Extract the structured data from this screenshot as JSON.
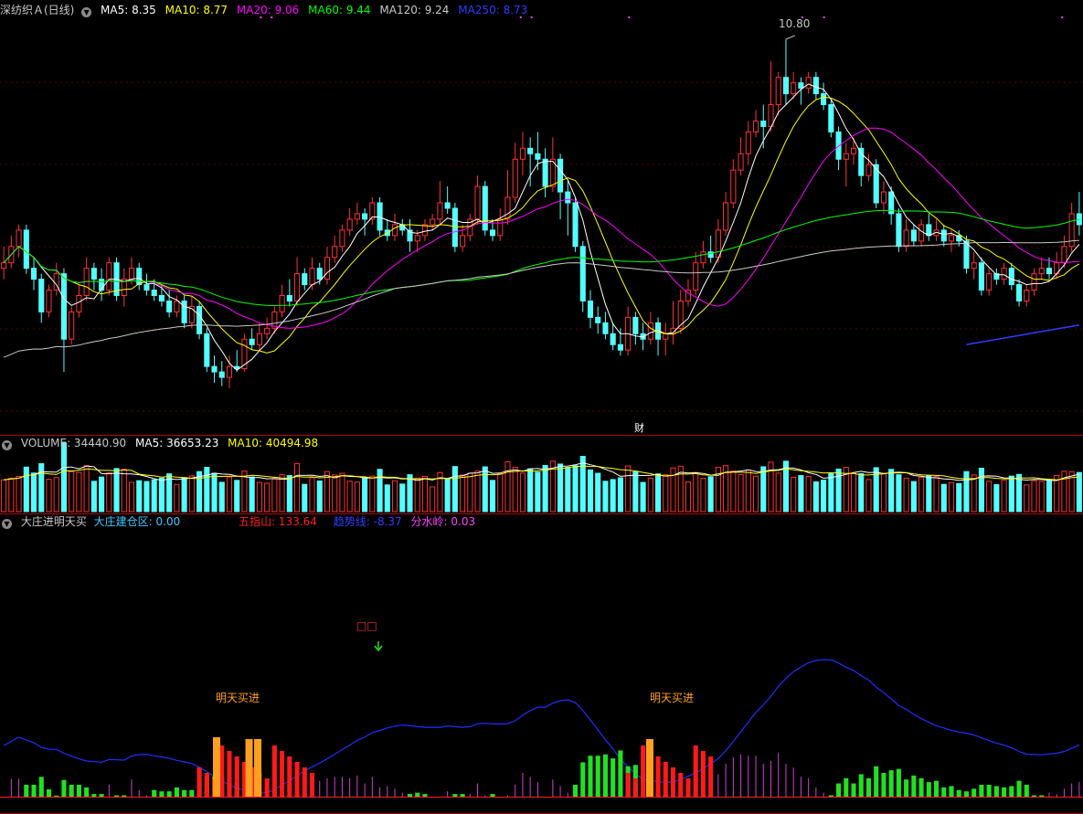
{
  "header_main": {
    "title": "深纺织Ａ(日线)",
    "ma5": "MA5: 8.35",
    "ma10": "MA10: 8.77",
    "ma20": "MA20: 9.06",
    "ma60": "MA60: 9.44",
    "ma120": "MA120: 9.24",
    "ma250": "MA250: 8.73",
    "colors": {
      "ma5": "#ffffff",
      "ma10": "#ffff00",
      "ma20": "#ff00ff",
      "ma60": "#00ff00",
      "ma120": "#c8c8c8",
      "ma250": "#2f3cff"
    }
  },
  "header_volume": {
    "volume": "VOLUME: 34440.90",
    "ma5": "MA5: 36653.23",
    "ma10": "MA10: 40494.98"
  },
  "header_indicator": {
    "name": "大庄进明天买",
    "build": "大庄建仓区: 0.00",
    "five": "五指山: 133.64",
    "trend": "趋势线: -8.37",
    "divide": "分水岭: 0.03"
  },
  "annotations": {
    "high_price": "10.80",
    "finance_marker": "财",
    "buy_signal_1": "明天买进",
    "buy_signal_2": "明天买进",
    "boxed_marker": "□□"
  },
  "chart_data": {
    "type": "candlestick",
    "price_range": [
      7.6,
      10.95
    ],
    "candles": [
      [
        8.7,
        8.75,
        8.9,
        8.6
      ],
      [
        8.75,
        8.9,
        9.0,
        8.7
      ],
      [
        8.9,
        9.05,
        9.1,
        8.8
      ],
      [
        9.05,
        8.7,
        9.1,
        8.65
      ],
      [
        8.7,
        8.6,
        8.8,
        8.5
      ],
      [
        8.6,
        8.3,
        8.65,
        8.2
      ],
      [
        8.3,
        8.5,
        8.55,
        8.25
      ],
      [
        8.5,
        8.65,
        8.75,
        8.45
      ],
      [
        8.65,
        8.05,
        8.7,
        7.75
      ],
      [
        8.05,
        8.3,
        8.35,
        8.0
      ],
      [
        8.3,
        8.45,
        8.55,
        8.25
      ],
      [
        8.45,
        8.7,
        8.8,
        8.4
      ],
      [
        8.7,
        8.6,
        8.75,
        8.5
      ],
      [
        8.6,
        8.5,
        8.7,
        8.4
      ],
      [
        8.5,
        8.75,
        8.8,
        8.45
      ],
      [
        8.75,
        8.45,
        8.8,
        8.4
      ],
      [
        8.45,
        8.6,
        8.7,
        8.35
      ],
      [
        8.6,
        8.7,
        8.8,
        8.55
      ],
      [
        8.7,
        8.55,
        8.75,
        8.5
      ],
      [
        8.55,
        8.5,
        8.65,
        8.45
      ],
      [
        8.5,
        8.45,
        8.6,
        8.4
      ],
      [
        8.45,
        8.4,
        8.55,
        8.35
      ],
      [
        8.4,
        8.3,
        8.5,
        8.25
      ],
      [
        8.3,
        8.4,
        8.45,
        8.25
      ],
      [
        8.4,
        8.2,
        8.45,
        8.15
      ],
      [
        8.2,
        8.35,
        8.45,
        8.15
      ],
      [
        8.35,
        8.1,
        8.4,
        8.05
      ],
      [
        8.1,
        7.8,
        8.15,
        7.75
      ],
      [
        7.8,
        7.75,
        7.9,
        7.65
      ],
      [
        7.75,
        7.7,
        7.85,
        7.62
      ],
      [
        7.7,
        7.8,
        7.9,
        7.6
      ],
      [
        7.8,
        7.78,
        7.95,
        7.75
      ],
      [
        7.78,
        8.05,
        8.1,
        7.75
      ],
      [
        8.05,
        8.0,
        8.15,
        7.95
      ],
      [
        8.0,
        8.1,
        8.2,
        7.95
      ],
      [
        8.1,
        8.15,
        8.25,
        8.05
      ],
      [
        8.15,
        8.3,
        8.35,
        8.1
      ],
      [
        8.3,
        8.45,
        8.55,
        8.25
      ],
      [
        8.45,
        8.4,
        8.6,
        8.35
      ],
      [
        8.4,
        8.65,
        8.8,
        8.35
      ],
      [
        8.65,
        8.55,
        8.7,
        8.5
      ],
      [
        8.55,
        8.7,
        8.8,
        8.5
      ],
      [
        8.7,
        8.6,
        8.75,
        8.55
      ],
      [
        8.6,
        8.8,
        8.9,
        8.55
      ],
      [
        8.8,
        8.9,
        9.0,
        8.75
      ],
      [
        8.9,
        9.05,
        9.1,
        8.85
      ],
      [
        9.05,
        9.15,
        9.25,
        9.0
      ],
      [
        9.15,
        9.2,
        9.3,
        9.1
      ],
      [
        9.2,
        9.15,
        9.25,
        9.0
      ],
      [
        9.15,
        9.3,
        9.35,
        9.1
      ],
      [
        9.3,
        9.05,
        9.35,
        9.0
      ],
      [
        9.05,
        9.0,
        9.15,
        8.95
      ],
      [
        9.0,
        9.1,
        9.2,
        8.95
      ],
      [
        9.1,
        9.05,
        9.15,
        9.0
      ],
      [
        9.05,
        8.95,
        9.15,
        8.85
      ],
      [
        8.95,
        9.0,
        9.05,
        8.85
      ],
      [
        9.0,
        9.1,
        9.15,
        8.95
      ],
      [
        9.1,
        9.15,
        9.2,
        9.05
      ],
      [
        9.15,
        9.3,
        9.5,
        9.1
      ],
      [
        9.3,
        9.25,
        9.45,
        9.2
      ],
      [
        9.25,
        8.9,
        9.3,
        8.85
      ],
      [
        8.9,
        9.0,
        9.1,
        8.85
      ],
      [
        9.0,
        9.15,
        9.2,
        8.95
      ],
      [
        9.15,
        9.45,
        9.55,
        9.1
      ],
      [
        9.45,
        9.05,
        9.5,
        9.0
      ],
      [
        9.05,
        9.0,
        9.15,
        8.95
      ],
      [
        9.0,
        9.15,
        9.25,
        8.95
      ],
      [
        9.15,
        9.35,
        9.6,
        9.1
      ],
      [
        9.35,
        9.7,
        9.85,
        9.3
      ],
      [
        9.7,
        9.8,
        9.95,
        9.55
      ],
      [
        9.8,
        9.75,
        9.9,
        9.45
      ],
      [
        9.75,
        9.7,
        9.95,
        9.6
      ],
      [
        9.7,
        9.45,
        9.8,
        9.35
      ],
      [
        9.45,
        9.7,
        9.9,
        9.4
      ],
      [
        9.7,
        9.4,
        9.75,
        9.15
      ],
      [
        9.4,
        9.3,
        9.5,
        9.0
      ],
      [
        9.3,
        8.9,
        9.35,
        8.85
      ],
      [
        8.9,
        8.4,
        8.95,
        8.3
      ],
      [
        8.4,
        8.25,
        8.5,
        8.15
      ],
      [
        8.25,
        8.2,
        8.35,
        8.1
      ],
      [
        8.2,
        8.1,
        8.3,
        8.05
      ],
      [
        8.1,
        8.0,
        8.2,
        7.95
      ],
      [
        8.0,
        7.95,
        8.15,
        7.9
      ],
      [
        7.95,
        8.25,
        8.35,
        7.9
      ],
      [
        8.25,
        8.1,
        8.3,
        8.0
      ],
      [
        8.1,
        8.05,
        8.2,
        7.95
      ],
      [
        8.05,
        8.2,
        8.3,
        8.0
      ],
      [
        8.2,
        8.05,
        8.25,
        7.9
      ],
      [
        8.05,
        8.1,
        8.2,
        7.9
      ],
      [
        8.1,
        8.15,
        8.4,
        8.0
      ],
      [
        8.15,
        8.4,
        8.5,
        8.1
      ],
      [
        8.4,
        8.5,
        8.6,
        8.35
      ],
      [
        8.5,
        8.75,
        8.85,
        8.45
      ],
      [
        8.75,
        8.85,
        8.95,
        8.7
      ],
      [
        8.85,
        8.8,
        9.0,
        8.75
      ],
      [
        8.8,
        9.05,
        9.15,
        8.75
      ],
      [
        9.05,
        9.3,
        9.4,
        9.0
      ],
      [
        9.3,
        9.6,
        9.7,
        9.25
      ],
      [
        9.6,
        9.75,
        9.9,
        9.55
      ],
      [
        9.75,
        9.95,
        10.05,
        9.65
      ],
      [
        9.95,
        10.05,
        10.15,
        9.9
      ],
      [
        10.05,
        10.0,
        10.2,
        9.8
      ],
      [
        10.0,
        10.2,
        10.6,
        9.95
      ],
      [
        10.2,
        10.45,
        10.5,
        10.1
      ],
      [
        10.45,
        10.3,
        10.8,
        10.2
      ],
      [
        10.3,
        10.4,
        10.5,
        10.25
      ],
      [
        10.4,
        10.35,
        10.45,
        10.2
      ],
      [
        10.35,
        10.45,
        10.5,
        10.3
      ],
      [
        10.45,
        10.3,
        10.5,
        10.25
      ],
      [
        10.3,
        10.2,
        10.4,
        10.15
      ],
      [
        10.2,
        9.95,
        10.25,
        9.9
      ],
      [
        9.95,
        9.7,
        10.0,
        9.6
      ],
      [
        9.7,
        9.75,
        9.85,
        9.45
      ],
      [
        9.75,
        9.8,
        9.9,
        9.65
      ],
      [
        9.8,
        9.55,
        9.85,
        9.45
      ],
      [
        9.55,
        9.65,
        9.75,
        9.5
      ],
      [
        9.65,
        9.3,
        9.7,
        9.25
      ],
      [
        9.3,
        9.4,
        9.5,
        9.2
      ],
      [
        9.4,
        9.2,
        9.45,
        9.1
      ],
      [
        9.2,
        8.9,
        9.25,
        8.85
      ],
      [
        8.9,
        9.05,
        9.15,
        8.85
      ],
      [
        9.05,
        8.95,
        9.1,
        8.9
      ],
      [
        8.95,
        9.1,
        9.15,
        8.9
      ],
      [
        9.1,
        9.0,
        9.2,
        8.95
      ],
      [
        9.0,
        9.05,
        9.15,
        8.95
      ],
      [
        9.05,
        8.95,
        9.1,
        8.9
      ],
      [
        8.95,
        9.0,
        9.05,
        8.85
      ],
      [
        9.0,
        8.95,
        9.05,
        8.9
      ],
      [
        8.95,
        8.7,
        9.0,
        8.65
      ],
      [
        8.7,
        8.75,
        8.85,
        8.6
      ],
      [
        8.75,
        8.5,
        8.8,
        8.45
      ],
      [
        8.5,
        8.65,
        8.7,
        8.45
      ],
      [
        8.65,
        8.6,
        8.7,
        8.55
      ],
      [
        8.6,
        8.7,
        8.75,
        8.55
      ],
      [
        8.7,
        8.55,
        8.75,
        8.5
      ],
      [
        8.55,
        8.4,
        8.6,
        8.35
      ],
      [
        8.4,
        8.5,
        8.55,
        8.35
      ],
      [
        8.5,
        8.65,
        8.7,
        8.45
      ],
      [
        8.65,
        8.7,
        8.8,
        8.6
      ],
      [
        8.7,
        8.65,
        8.8,
        8.6
      ],
      [
        8.65,
        8.75,
        8.85,
        8.6
      ],
      [
        8.75,
        8.9,
        9.0,
        8.7
      ],
      [
        8.9,
        9.2,
        9.3,
        8.85
      ],
      [
        9.2,
        9.1,
        9.4,
        9.0
      ]
    ],
    "volume_range": [
      0,
      95000
    ],
    "indicator_range": [
      0,
      150
    ],
    "trend_line_range": [
      -60,
      40
    ]
  }
}
